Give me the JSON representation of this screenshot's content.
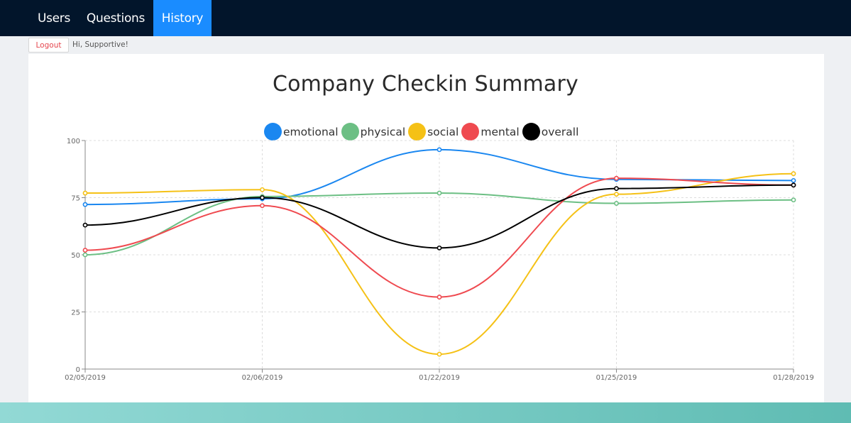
{
  "nav": {
    "users_label": "Users",
    "questions_label": "Questions",
    "history_label": "History"
  },
  "session": {
    "logout_label": "Logout",
    "greeting": "Hi, Supportive!"
  },
  "chart_data": {
    "type": "line",
    "title": "Company Checkin Summary",
    "xlabel": "",
    "ylabel": "",
    "categories": [
      "02/05/2019",
      "02/06/2019",
      "01/22/2019",
      "01/25/2019",
      "01/28/2019"
    ],
    "ylim": [
      0,
      100
    ],
    "yticks": [
      0,
      25,
      50,
      75,
      100
    ],
    "grid": true,
    "legend_position": "top-center",
    "series": [
      {
        "name": "emotional",
        "color": "#1a87f0",
        "values": [
          72,
          74.5,
          96,
          83,
          82.5
        ]
      },
      {
        "name": "physical",
        "color": "#6cbf84",
        "values": [
          50,
          75.5,
          77,
          72.5,
          74
        ]
      },
      {
        "name": "social",
        "color": "#f5c116",
        "values": [
          77,
          78.5,
          6.5,
          76.5,
          85.5
        ]
      },
      {
        "name": "mental",
        "color": "#ef4a50",
        "values": [
          52,
          71.5,
          31.5,
          83.5,
          80.5
        ]
      },
      {
        "name": "overall",
        "color": "#000000",
        "values": [
          63,
          75,
          53,
          79,
          80.5
        ]
      }
    ]
  }
}
